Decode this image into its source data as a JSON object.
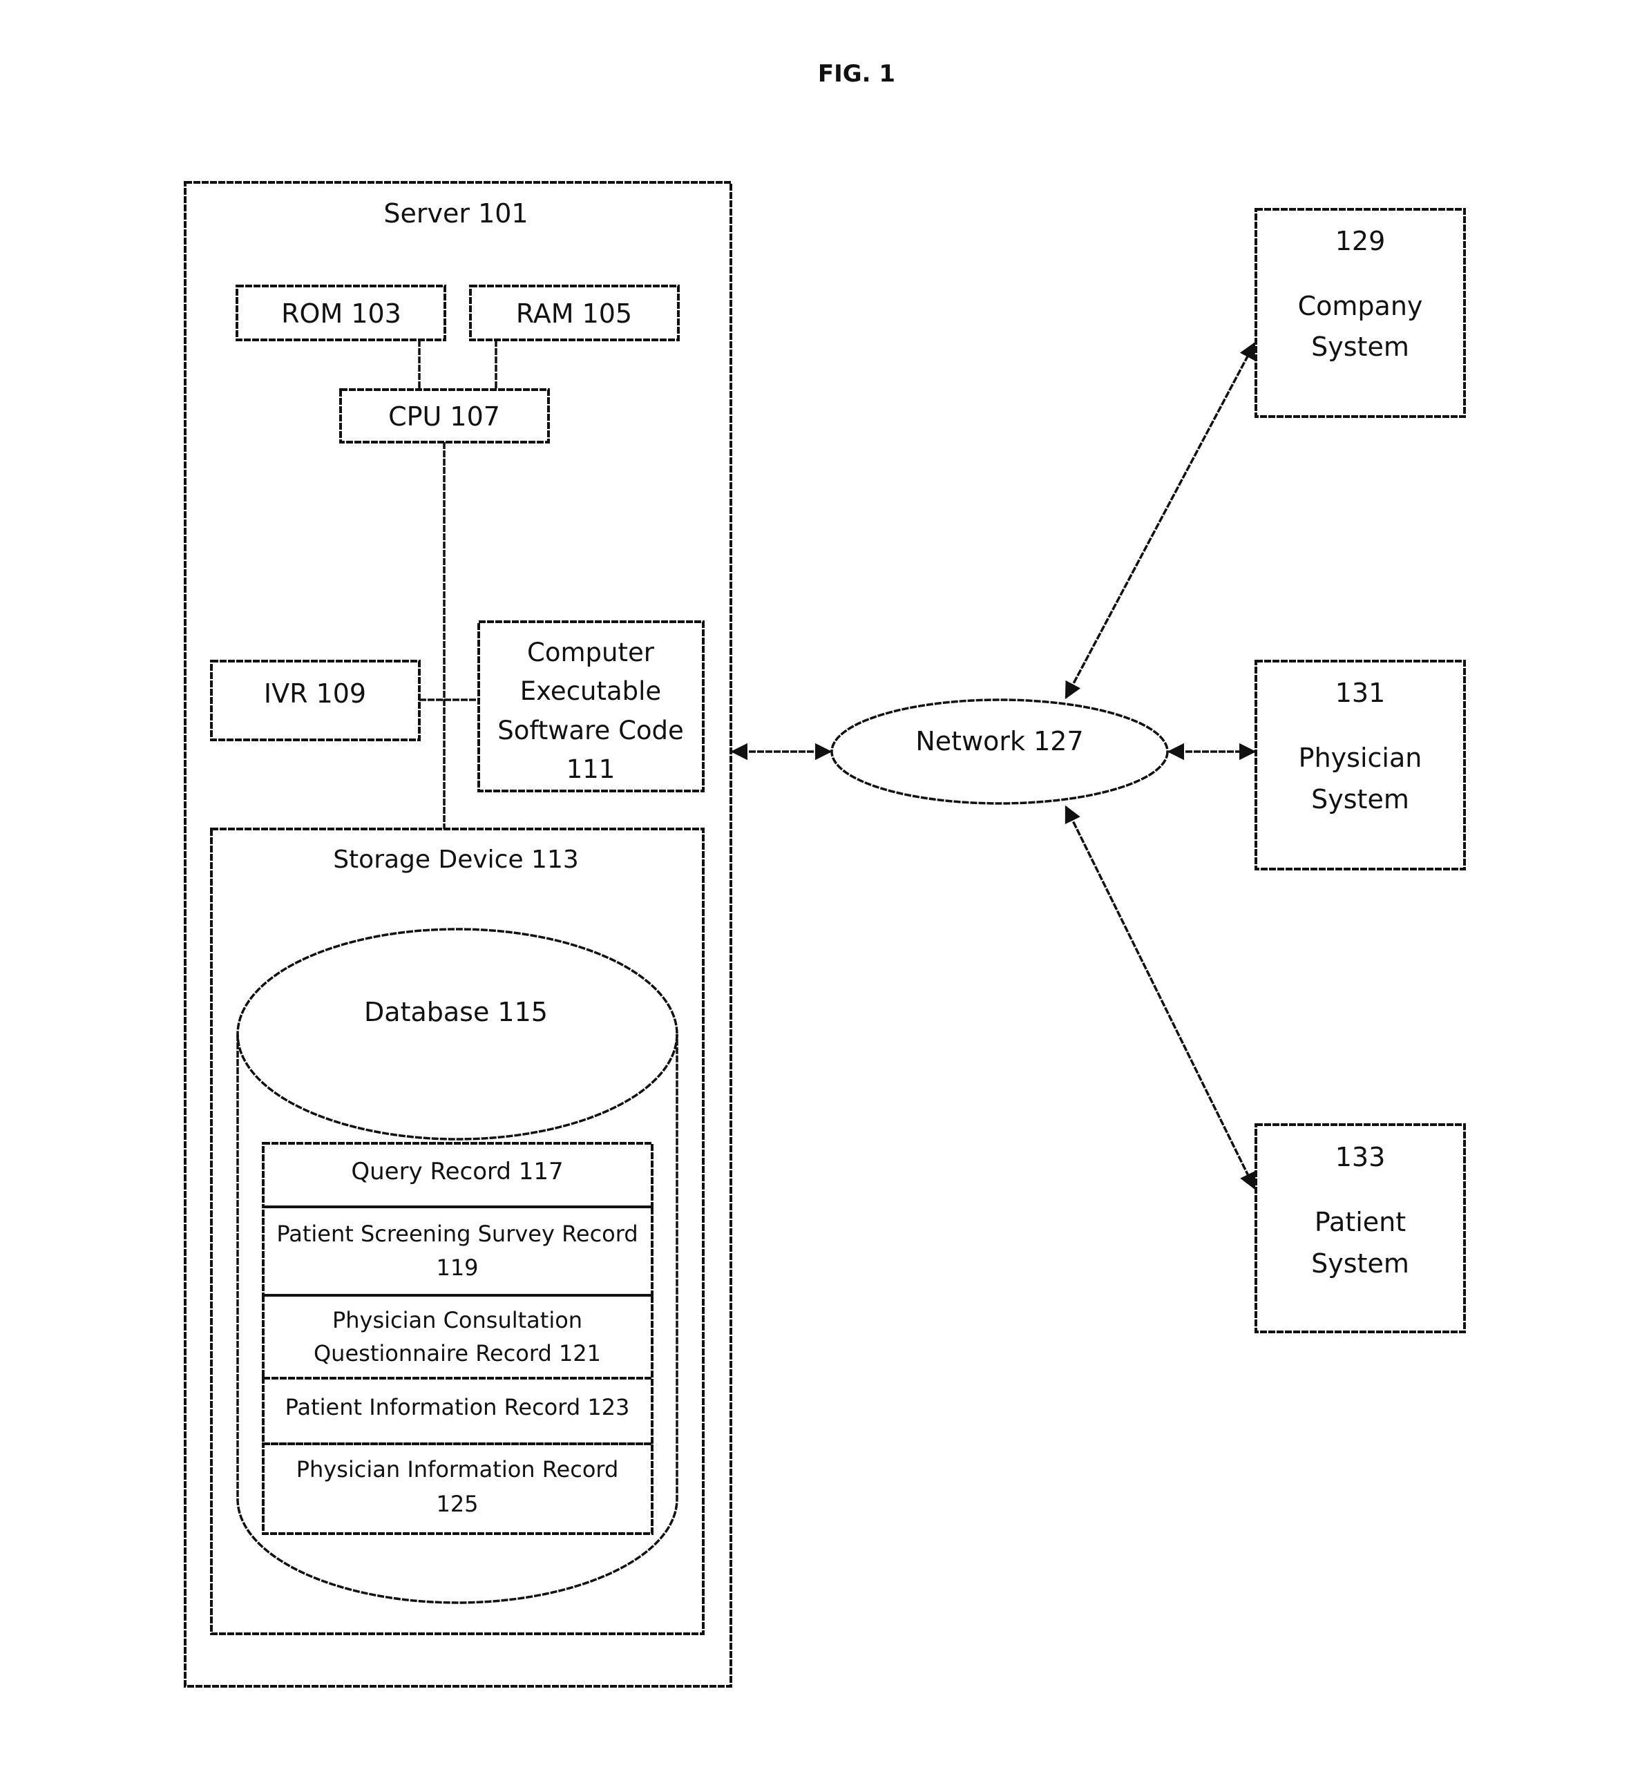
{
  "figure": {
    "title": "FIG. 1"
  },
  "server": {
    "label": "Server 101",
    "rom": "ROM 103",
    "ram": "RAM 105",
    "cpu": "CPU 107",
    "ivr": "IVR 109",
    "software_code": [
      "Computer",
      "Executable",
      "Software Code",
      "111"
    ],
    "storage": {
      "label": "Storage Device 113",
      "database": {
        "label": "Database 115",
        "records": [
          {
            "lines": [
              "Query Record 117"
            ]
          },
          {
            "lines": [
              "Patient Screening Survey Record",
              "119"
            ]
          },
          {
            "lines": [
              "Physician Consultation",
              "Questionnaire Record 121"
            ]
          },
          {
            "lines": [
              "Patient Information Record  123"
            ]
          },
          {
            "lines": [
              "Physician Information Record",
              "125"
            ]
          }
        ]
      }
    }
  },
  "network": {
    "label": "Network 127"
  },
  "external_systems": [
    {
      "number": "129",
      "lines": [
        "Company",
        "System"
      ]
    },
    {
      "number": "131",
      "lines": [
        "Physician",
        "System"
      ]
    },
    {
      "number": "133",
      "lines": [
        "Patient",
        "System"
      ]
    }
  ],
  "colors": {
    "ink": "#111111",
    "background": "#ffffff"
  }
}
